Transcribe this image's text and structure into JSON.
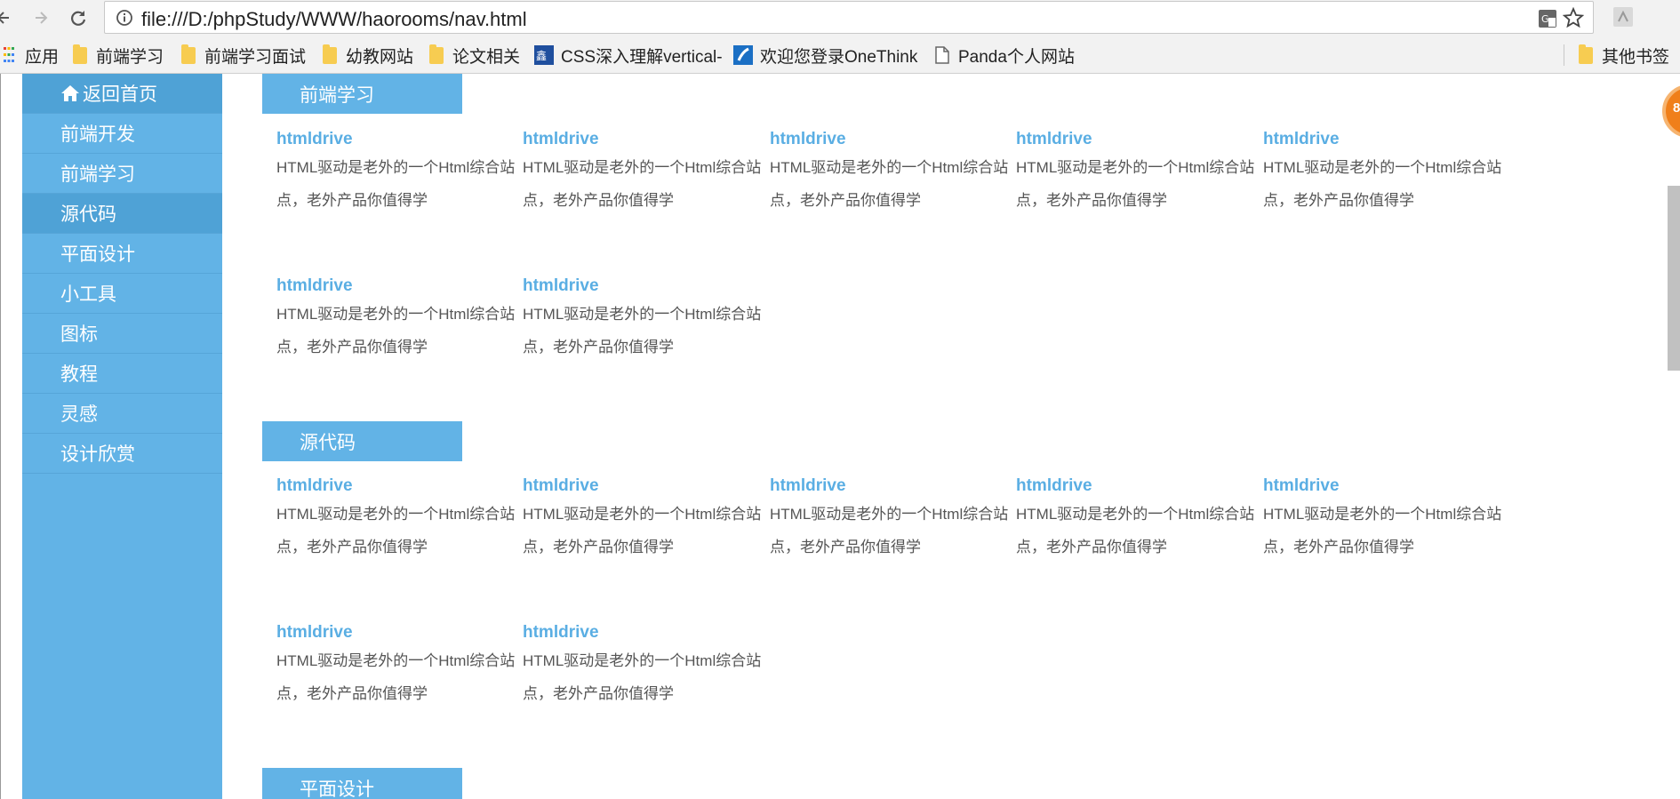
{
  "browser": {
    "url": "file:///D:/phpStudy/WWW/haorooms/nav.html",
    "bookmarks": [
      {
        "label": "应用",
        "icon": "apps-grid-icon"
      },
      {
        "label": "前端学习",
        "icon": "folder-icon"
      },
      {
        "label": "前端学习面试",
        "icon": "folder-icon"
      },
      {
        "label": "幼教网站",
        "icon": "folder-icon"
      },
      {
        "label": "论文相关",
        "icon": "folder-icon"
      },
      {
        "label": "CSS深入理解vertical-",
        "icon": "site-icon"
      },
      {
        "label": "欢迎您登录OneThink",
        "icon": "site-icon"
      },
      {
        "label": "Panda个人网站",
        "icon": "page-icon"
      }
    ],
    "other_bookmarks": "其他书签"
  },
  "sidebar": {
    "items": [
      {
        "label": "返回首页"
      },
      {
        "label": "前端开发"
      },
      {
        "label": "前端学习"
      },
      {
        "label": "源代码"
      },
      {
        "label": "平面设计"
      },
      {
        "label": "小工具"
      },
      {
        "label": "图标"
      },
      {
        "label": "教程"
      },
      {
        "label": "灵感"
      },
      {
        "label": "设计欣赏"
      }
    ]
  },
  "sections": [
    {
      "title": "前端学习",
      "cards": [
        {
          "title": "htmldrive",
          "desc": "HTML驱动是老外的一个Html综合站点，老外产品你值得学"
        },
        {
          "title": "htmldrive",
          "desc": "HTML驱动是老外的一个Html综合站点，老外产品你值得学"
        },
        {
          "title": "htmldrive",
          "desc": "HTML驱动是老外的一个Html综合站点，老外产品你值得学"
        },
        {
          "title": "htmldrive",
          "desc": "HTML驱动是老外的一个Html综合站点，老外产品你值得学"
        },
        {
          "title": "htmldrive",
          "desc": "HTML驱动是老外的一个Html综合站点，老外产品你值得学"
        },
        {
          "title": "htmldrive",
          "desc": "HTML驱动是老外的一个Html综合站点，老外产品你值得学"
        },
        {
          "title": "htmldrive",
          "desc": "HTML驱动是老外的一个Html综合站点，老外产品你值得学"
        }
      ]
    },
    {
      "title": "源代码",
      "cards": [
        {
          "title": "htmldrive",
          "desc": "HTML驱动是老外的一个Html综合站点，老外产品你值得学"
        },
        {
          "title": "htmldrive",
          "desc": "HTML驱动是老外的一个Html综合站点，老外产品你值得学"
        },
        {
          "title": "htmldrive",
          "desc": "HTML驱动是老外的一个Html综合站点，老外产品你值得学"
        },
        {
          "title": "htmldrive",
          "desc": "HTML驱动是老外的一个Html综合站点，老外产品你值得学"
        },
        {
          "title": "htmldrive",
          "desc": "HTML驱动是老外的一个Html综合站点，老外产品你值得学"
        },
        {
          "title": "htmldrive",
          "desc": "HTML驱动是老外的一个Html综合站点，老外产品你值得学"
        },
        {
          "title": "htmldrive",
          "desc": "HTML驱动是老外的一个Html综合站点，老外产品你值得学"
        }
      ]
    },
    {
      "title": "平面设计",
      "cards": []
    }
  ],
  "badge_text": "8",
  "colors": {
    "accent": "#62b3e6",
    "title_link": "#5aaee3"
  }
}
